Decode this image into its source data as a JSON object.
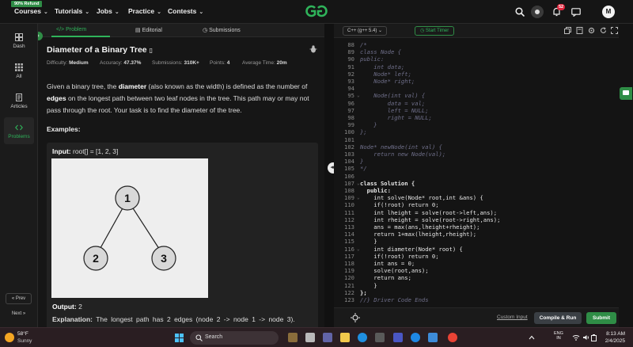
{
  "nav": {
    "refund_badge": "90% Refund",
    "items": [
      "Courses",
      "Tutorials",
      "Jobs",
      "Practice",
      "Contests"
    ],
    "notification_count": "52",
    "avatar_initial": "M"
  },
  "sidebar": {
    "items": [
      "Dash",
      "All",
      "Articles",
      "Problems"
    ],
    "prev_label": "« Prev",
    "next_label": "Next »"
  },
  "tabs": [
    "Problem",
    "Editorial",
    "Submissions"
  ],
  "problem": {
    "title": "Diameter of a Binary Tree",
    "difficulty_label": "Difficulty:",
    "difficulty": "Medium",
    "accuracy_label": "Accuracy:",
    "accuracy": "47.37%",
    "submissions_label": "Submissions:",
    "submissions": "310K+",
    "points_label": "Points:",
    "points": "4",
    "avg_time_label": "Average Time:",
    "avg_time": "20m",
    "desc_1": "Given a binary tree, the ",
    "desc_b1": "diameter",
    "desc_2": " (also known as the width) is defined as the number of ",
    "desc_b2": "edges",
    "desc_3": " on the longest path between two leaf nodes in the tree. This path may or may not pass through the root. Your task is to find the diameter of the tree.",
    "examples_label": "Examples:",
    "input_label": "Input:",
    "input_value": "root[] = [1, 2, 3]",
    "tree_nodes": [
      "1",
      "2",
      "3"
    ],
    "output_label": "Output:",
    "output_value": "2",
    "explanation_label": "Explanation:",
    "explanation_value": "The longest path has 2 edges (node 2 -> node 1 -> node 3)."
  },
  "editor": {
    "language": "C++ (g++ 5.4)",
    "timer_label": "Start Timer",
    "custom_input": "Custom Input",
    "compile_label": "Compile & Run",
    "submit_label": "Submit",
    "lines": [
      {
        "n": "88",
        "f": "",
        "t": "/*",
        "c": "cm"
      },
      {
        "n": "89",
        "f": "",
        "t": "class Node {",
        "c": "cm"
      },
      {
        "n": "90",
        "f": "",
        "t": "public:",
        "c": "cm"
      },
      {
        "n": "91",
        "f": "",
        "t": "    int data;",
        "c": "cm"
      },
      {
        "n": "92",
        "f": "",
        "t": "    Node* left;",
        "c": "cm"
      },
      {
        "n": "93",
        "f": "",
        "t": "    Node* right;",
        "c": "cm"
      },
      {
        "n": "94",
        "f": "",
        "t": "",
        "c": "cm"
      },
      {
        "n": "95",
        "f": "⌄",
        "t": "    Node(int val) {",
        "c": "cm"
      },
      {
        "n": "96",
        "f": "",
        "t": "        data = val;",
        "c": "cm"
      },
      {
        "n": "97",
        "f": "",
        "t": "        left = NULL;",
        "c": "cm"
      },
      {
        "n": "98",
        "f": "",
        "t": "        right = NULL;",
        "c": "cm"
      },
      {
        "n": "99",
        "f": "",
        "t": "    }",
        "c": "cm"
      },
      {
        "n": "100",
        "f": "",
        "t": "};",
        "c": "cm"
      },
      {
        "n": "101",
        "f": "",
        "t": "",
        "c": "cm"
      },
      {
        "n": "102",
        "f": "",
        "t": "Node* newNode(int val) {",
        "c": "cm"
      },
      {
        "n": "103",
        "f": "",
        "t": "    return new Node(val);",
        "c": "cm"
      },
      {
        "n": "104",
        "f": "",
        "t": "}",
        "c": "cm"
      },
      {
        "n": "105",
        "f": "",
        "t": "*/",
        "c": "cm"
      },
      {
        "n": "106",
        "f": "",
        "t": "",
        "c": ""
      },
      {
        "n": "107",
        "f": "⌄",
        "t": "class Solution {",
        "c": "kw"
      },
      {
        "n": "108",
        "f": "",
        "t": "  public:",
        "c": "kw"
      },
      {
        "n": "109",
        "f": "⌄",
        "t": "    int solve(Node* root,int &ans) {",
        "c": "code"
      },
      {
        "n": "110",
        "f": "",
        "t": "    if(!root) return 0;",
        "c": "code"
      },
      {
        "n": "111",
        "f": "",
        "t": "    int lheight = solve(root->left,ans);",
        "c": "code"
      },
      {
        "n": "112",
        "f": "",
        "t": "    int rheight = solve(root->right,ans);",
        "c": "code"
      },
      {
        "n": "113",
        "f": "",
        "t": "    ans = max(ans,lheight+rheight);",
        "c": "code"
      },
      {
        "n": "114",
        "f": "",
        "t": "    return 1+max(lheight,rheight);",
        "c": "code"
      },
      {
        "n": "115",
        "f": "",
        "t": "    }",
        "c": "code"
      },
      {
        "n": "116",
        "f": "⌄",
        "t": "    int diameter(Node* root) {",
        "c": "code"
      },
      {
        "n": "117",
        "f": "",
        "t": "    if(!root) return 0;",
        "c": "code"
      },
      {
        "n": "118",
        "f": "",
        "t": "    int ans = 0;",
        "c": "code"
      },
      {
        "n": "119",
        "f": "",
        "t": "    solve(root,ans);",
        "c": "code"
      },
      {
        "n": "120",
        "f": "",
        "t": "    return ans;",
        "c": "code"
      },
      {
        "n": "121",
        "f": "",
        "t": "    }",
        "c": "code"
      },
      {
        "n": "122",
        "f": "",
        "t": "};",
        "c": "kw"
      },
      {
        "n": "123",
        "f": "",
        "t": "//} Driver Code Ends",
        "c": "cm"
      }
    ]
  },
  "taskbar": {
    "temp": "58°F",
    "weather": "Sunny",
    "search_placeholder": "Search",
    "lang": "ENG",
    "region": "IN",
    "time": "8:13 AM",
    "date": "2/4/2025"
  },
  "colors": {
    "accent": "#2f8d46",
    "accent_text": "#2fb35a"
  }
}
